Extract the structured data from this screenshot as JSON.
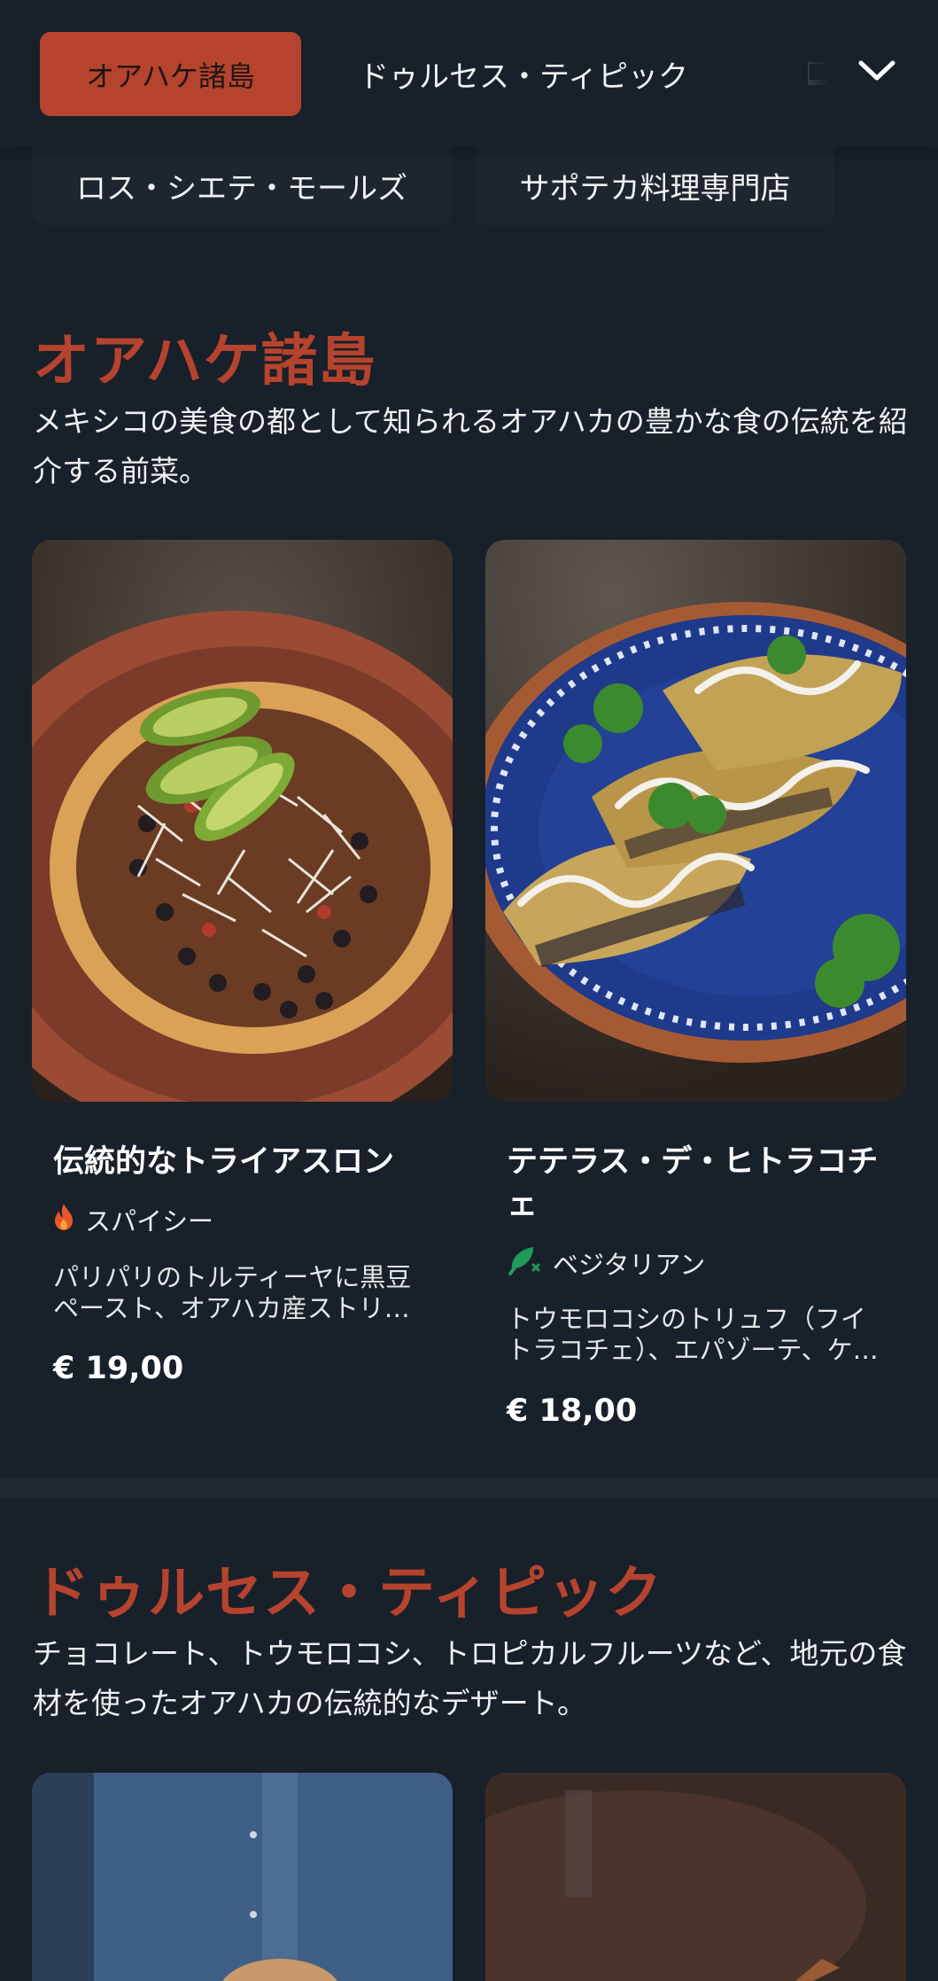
{
  "nav": {
    "active_tab": "オアハケ諸島",
    "tabs": [
      "ドゥルセス・ティピック"
    ],
    "more_icon": "chevron-down-icon",
    "row2": [
      "ロス・シエテ・モールズ",
      "サポテカ料理専門店"
    ]
  },
  "sections": [
    {
      "title": "オアハケ諸島",
      "description": "メキシコの美食の都として知られるオアハカの豊かな食の伝統を紹介する前菜。",
      "items": [
        {
          "name": "伝統的なトライアスロン",
          "tag": "スパイシー",
          "tag_icon": "flame-icon",
          "description": "パリパリのトルティーヤに黒豆ペースト、オアハカ産ストリ…",
          "price": "€ 19,00"
        },
        {
          "name": "テテラス・デ・ヒトラコチェ",
          "tag": "ベジタリアン",
          "tag_icon": "vegetarian-leaf-icon",
          "description": "トウモロコシのトリュフ（フイトラコチェ）、エパゾーテ、ケ…",
          "price": "€ 18,00"
        }
      ]
    },
    {
      "title": "ドゥルセス・ティピック",
      "description": "チョコレート、トウモロコシ、トロピカルフルーツなど、地元の食材を使ったオアハカの伝統的なデザート。"
    }
  ],
  "colors": {
    "background": "#18202a",
    "accent": "#b5432d",
    "spicy": "#e8562a",
    "vegetarian": "#1f9a5a"
  }
}
